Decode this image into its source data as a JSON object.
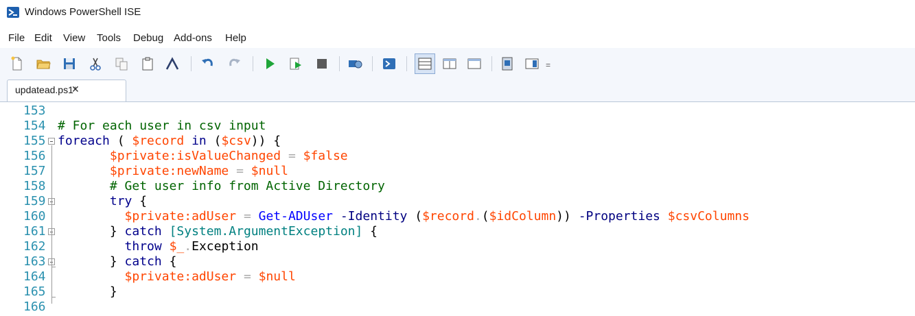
{
  "window": {
    "title": "Windows PowerShell ISE"
  },
  "menu": [
    "File",
    "Edit",
    "View",
    "Tools",
    "Debug",
    "Add-ons",
    "Help"
  ],
  "toolbar": {
    "buttons": [
      "new-file-icon",
      "open-folder-icon",
      "save-icon",
      "cut-icon",
      "copy-icon",
      "paste-icon",
      "clear-console-icon",
      "undo-icon",
      "redo-icon",
      "run-script-icon",
      "run-selection-icon",
      "stop-icon",
      "remote-powershell-icon",
      "start-powershell-icon",
      "layout-top-icon",
      "layout-right-icon",
      "layout-max-icon",
      "show-script-pane-icon",
      "show-command-addon-icon"
    ],
    "overflow_label": "="
  },
  "tabs": [
    {
      "label": "updatead.ps1*",
      "close": "✕"
    }
  ],
  "editor": {
    "lines": [
      {
        "n": "153",
        "tokens": []
      },
      {
        "n": "154",
        "tokens": [
          {
            "t": "# For each user in csv input",
            "c": "comment"
          }
        ]
      },
      {
        "n": "155",
        "tokens": [
          {
            "t": "foreach",
            "c": "kw"
          },
          {
            "t": " ( ",
            "c": "plain"
          },
          {
            "t": "$record",
            "c": "var"
          },
          {
            "t": " in ",
            "c": "kw"
          },
          {
            "t": "(",
            "c": "plain"
          },
          {
            "t": "$csv",
            "c": "var"
          },
          {
            "t": ")) {",
            "c": "plain"
          }
        ]
      },
      {
        "n": "156",
        "tokens": [
          {
            "t": "       ",
            "c": "plain"
          },
          {
            "t": "$private:isValueChanged",
            "c": "var"
          },
          {
            "t": " = ",
            "c": "op"
          },
          {
            "t": "$false",
            "c": "var"
          }
        ]
      },
      {
        "n": "157",
        "tokens": [
          {
            "t": "       ",
            "c": "plain"
          },
          {
            "t": "$private:newName",
            "c": "var"
          },
          {
            "t": " = ",
            "c": "op"
          },
          {
            "t": "$null",
            "c": "var"
          }
        ]
      },
      {
        "n": "158",
        "tokens": [
          {
            "t": "       ",
            "c": "plain"
          },
          {
            "t": "# Get user info from Active Directory",
            "c": "comment"
          }
        ]
      },
      {
        "n": "159",
        "tokens": [
          {
            "t": "       ",
            "c": "plain"
          },
          {
            "t": "try",
            "c": "kw"
          },
          {
            "t": " {",
            "c": "plain"
          }
        ]
      },
      {
        "n": "160",
        "tokens": [
          {
            "t": "         ",
            "c": "plain"
          },
          {
            "t": "$private:adUser",
            "c": "var"
          },
          {
            "t": " = ",
            "c": "op"
          },
          {
            "t": "Get-ADUser",
            "c": "cmd"
          },
          {
            "t": " ",
            "c": "plain"
          },
          {
            "t": "-Identity",
            "c": "param"
          },
          {
            "t": " (",
            "c": "plain"
          },
          {
            "t": "$record",
            "c": "var"
          },
          {
            "t": ".",
            "c": "op"
          },
          {
            "t": "(",
            "c": "plain"
          },
          {
            "t": "$idColumn",
            "c": "var"
          },
          {
            "t": ")) ",
            "c": "plain"
          },
          {
            "t": "-Properties",
            "c": "param"
          },
          {
            "t": " ",
            "c": "plain"
          },
          {
            "t": "$csvColumns",
            "c": "var"
          }
        ]
      },
      {
        "n": "161",
        "tokens": [
          {
            "t": "       } ",
            "c": "plain"
          },
          {
            "t": "catch",
            "c": "kw"
          },
          {
            "t": " ",
            "c": "plain"
          },
          {
            "t": "[System.ArgumentException]",
            "c": "type"
          },
          {
            "t": " {",
            "c": "plain"
          }
        ]
      },
      {
        "n": "162",
        "tokens": [
          {
            "t": "         ",
            "c": "plain"
          },
          {
            "t": "throw",
            "c": "kw"
          },
          {
            "t": " ",
            "c": "plain"
          },
          {
            "t": "$_",
            "c": "var"
          },
          {
            "t": ".",
            "c": "op"
          },
          {
            "t": "Exception",
            "c": "member"
          }
        ]
      },
      {
        "n": "163",
        "tokens": [
          {
            "t": "       } ",
            "c": "plain"
          },
          {
            "t": "catch",
            "c": "kw"
          },
          {
            "t": " {",
            "c": "plain"
          }
        ]
      },
      {
        "n": "164",
        "tokens": [
          {
            "t": "         ",
            "c": "plain"
          },
          {
            "t": "$private:adUser",
            "c": "var"
          },
          {
            "t": " = ",
            "c": "op"
          },
          {
            "t": "$null",
            "c": "var"
          }
        ]
      },
      {
        "n": "165",
        "tokens": [
          {
            "t": "       }",
            "c": "plain"
          }
        ]
      },
      {
        "n": "166",
        "tokens": []
      }
    ]
  }
}
